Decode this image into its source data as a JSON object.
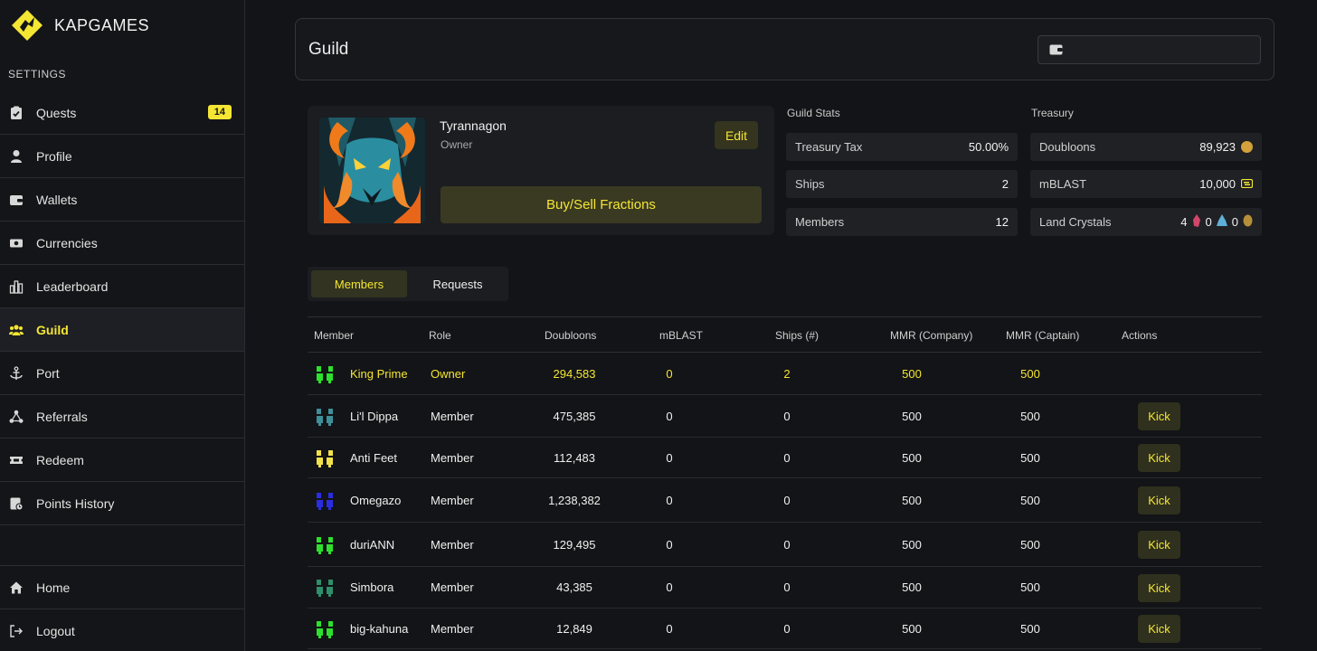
{
  "app": {
    "name": "KAPGAMES"
  },
  "sidebar": {
    "section_label": "SETTINGS",
    "items": [
      {
        "label": "Quests",
        "icon": "clipboard-check-icon",
        "badge": "14"
      },
      {
        "label": "Profile",
        "icon": "user-icon"
      },
      {
        "label": "Wallets",
        "icon": "wallet-icon"
      },
      {
        "label": "Currencies",
        "icon": "cash-icon"
      },
      {
        "label": "Leaderboard",
        "icon": "bar-chart-icon"
      },
      {
        "label": "Guild",
        "icon": "users-icon",
        "active": true
      },
      {
        "label": "Port",
        "icon": "anchor-icon"
      },
      {
        "label": "Referrals",
        "icon": "network-icon"
      },
      {
        "label": "Redeem",
        "icon": "ticket-icon"
      },
      {
        "label": "Points History",
        "icon": "history-icon"
      }
    ],
    "bottom_items": [
      {
        "label": "Home",
        "icon": "home-icon"
      },
      {
        "label": "Logout",
        "icon": "logout-icon"
      }
    ]
  },
  "header": {
    "title": "Guild"
  },
  "guild": {
    "name": "Tyrannagon",
    "role": "Owner",
    "edit_label": "Edit",
    "buy_sell_label": "Buy/Sell Fractions"
  },
  "guild_stats": {
    "title": "Guild Stats",
    "rows": [
      {
        "label": "Treasury Tax",
        "value": "50.00%"
      },
      {
        "label": "Ships",
        "value": "2"
      },
      {
        "label": "Members",
        "value": "12"
      }
    ]
  },
  "treasury": {
    "title": "Treasury",
    "doubloons": {
      "label": "Doubloons",
      "value": "89,923"
    },
    "mblast": {
      "label": "mBLAST",
      "value": "10,000"
    },
    "land_crystals": {
      "label": "Land Crystals",
      "values": [
        "4",
        "0",
        "0"
      ]
    }
  },
  "tabs": {
    "members": "Members",
    "requests": "Requests"
  },
  "table": {
    "headers": [
      "Member",
      "Role",
      "Doubloons",
      "mBLAST",
      "Ships (#)",
      "MMR (Company)",
      "MMR (Captain)",
      "Actions"
    ],
    "kick_label": "Kick",
    "rows": [
      {
        "name": "King Prime",
        "role": "Owner",
        "doubloons": "294,583",
        "mblast": "0",
        "ships": "2",
        "mmr_company": "500",
        "mmr_captain": "500",
        "avatar_color": "#2ee02e"
      },
      {
        "name": "Li'l Dippa",
        "role": "Member",
        "doubloons": "475,385",
        "mblast": "0",
        "ships": "0",
        "mmr_company": "500",
        "mmr_captain": "500",
        "avatar_color": "#3f8f9a"
      },
      {
        "name": "Anti Feet",
        "role": "Member",
        "doubloons": "112,483",
        "mblast": "0",
        "ships": "0",
        "mmr_company": "500",
        "mmr_captain": "500",
        "avatar_color": "#f2e24a"
      },
      {
        "name": "Omegazo",
        "role": "Member",
        "doubloons": "1,238,382",
        "mblast": "0",
        "ships": "0",
        "mmr_company": "500",
        "mmr_captain": "500",
        "avatar_color": "#2a2ee0"
      },
      {
        "name": "duriANN",
        "role": "Member",
        "doubloons": "129,495",
        "mblast": "0",
        "ships": "0",
        "mmr_company": "500",
        "mmr_captain": "500",
        "avatar_color": "#2ee02e"
      },
      {
        "name": "Simbora",
        "role": "Member",
        "doubloons": "43,385",
        "mblast": "0",
        "ships": "0",
        "mmr_company": "500",
        "mmr_captain": "500",
        "avatar_color": "#2f8f6a"
      },
      {
        "name": "big-kahuna",
        "role": "Member",
        "doubloons": "12,849",
        "mblast": "0",
        "ships": "0",
        "mmr_company": "500",
        "mmr_captain": "500",
        "avatar_color": "#2ee02e"
      }
    ]
  },
  "colors": {
    "accent": "#f4e633",
    "background": "#131417"
  }
}
